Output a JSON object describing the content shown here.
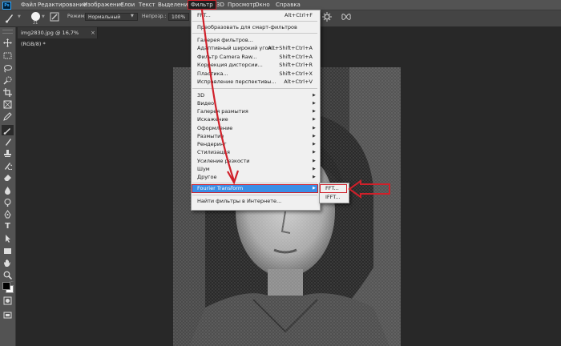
{
  "menubar": {
    "items": [
      "Файл",
      "Редактирование",
      "Изображение",
      "Слои",
      "Текст",
      "Выделение",
      "Фильтр",
      "3D",
      "Просмотр",
      "Окно",
      "Справка"
    ]
  },
  "options": {
    "brush_size": "21",
    "mode_label": "Режим:",
    "mode_value": "Нормальный",
    "opacity_label": "Непрозр.:",
    "opacity_value": "100%"
  },
  "document": {
    "tab_title": "img2830.jpg @ 16,7% (RGB/8) *",
    "close_symbol": "×"
  },
  "filter_menu": {
    "last_filter": {
      "label": "FFT...",
      "shortcut": "Alt+Ctrl+F"
    },
    "smart_filters": "Преобразовать для смарт-фильтров",
    "group1": [
      {
        "label": "Галерея фильтров...",
        "shortcut": ""
      },
      {
        "label": "Адаптивный широкий угол...",
        "shortcut": "Alt+Shift+Ctrl+A"
      },
      {
        "label": "Фильтр Camera Raw...",
        "shortcut": "Shift+Ctrl+A"
      },
      {
        "label": "Коррекция дисторсии...",
        "shortcut": "Shift+Ctrl+R"
      },
      {
        "label": "Пластика...",
        "shortcut": "Shift+Ctrl+X"
      },
      {
        "label": "Исправление перспективы...",
        "shortcut": "Alt+Ctrl+V"
      }
    ],
    "submenus": [
      "3D",
      "Видео",
      "Галерея размытия",
      "Искажение",
      "Оформление",
      "Размытие",
      "Рендеринг",
      "Стилизация",
      "Усиление резкости",
      "Шум",
      "Другое"
    ],
    "fourier": "Fourier Transform",
    "find_online": "Найти фильтры в Интернете...",
    "arrow": "▶"
  },
  "fourier_submenu": {
    "items": [
      "FFT...",
      "IFFT..."
    ]
  },
  "colors": {
    "accent_red": "#d0202a",
    "highlight_blue": "#3a8ee6",
    "menu_bg": "#f0f0f0",
    "chrome_bg": "#535353"
  }
}
